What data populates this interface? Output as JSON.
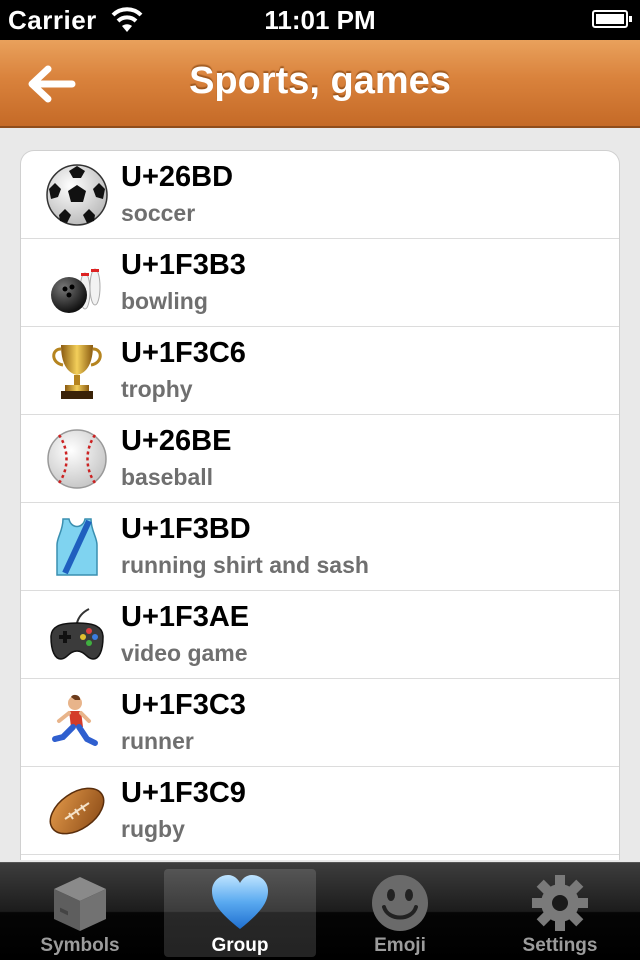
{
  "status_bar": {
    "carrier": "Carrier",
    "time": "11:01 PM"
  },
  "nav": {
    "title": "Sports, games",
    "back_icon": "back-arrow-icon",
    "accent_color": "#d9823c"
  },
  "list": {
    "items": [
      {
        "code": "U+26BD",
        "desc": "soccer",
        "icon": "soccer-ball-icon"
      },
      {
        "code": "U+1F3B3",
        "desc": "bowling",
        "icon": "bowling-icon"
      },
      {
        "code": "U+1F3C6",
        "desc": "trophy",
        "icon": "trophy-icon"
      },
      {
        "code": "U+26BE",
        "desc": "baseball",
        "icon": "baseball-icon"
      },
      {
        "code": "U+1F3BD",
        "desc": "running shirt and sash",
        "icon": "running-shirt-icon"
      },
      {
        "code": "U+1F3AE",
        "desc": "video game",
        "icon": "video-game-icon"
      },
      {
        "code": "U+1F3C3",
        "desc": "runner",
        "icon": "runner-icon"
      },
      {
        "code": "U+1F3C9",
        "desc": "rugby",
        "icon": "rugby-ball-icon"
      }
    ]
  },
  "tabs": [
    {
      "label": "Symbols",
      "icon": "box-icon",
      "selected": false
    },
    {
      "label": "Group",
      "icon": "heart-icon",
      "selected": true
    },
    {
      "label": "Emoji",
      "icon": "smiley-icon",
      "selected": false
    },
    {
      "label": "Settings",
      "icon": "gear-icon",
      "selected": false
    }
  ]
}
